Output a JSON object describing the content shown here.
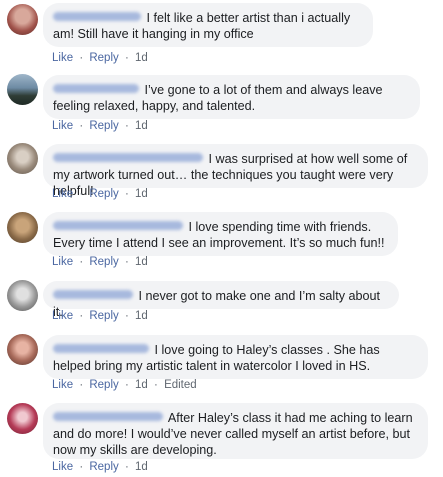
{
  "comments": [
    {
      "text": "I felt like a better artist than i actually am! Still have it hanging in my office",
      "actions": {
        "like": "Like",
        "reply": "Reply",
        "sep": "·",
        "time": "1d"
      }
    },
    {
      "text": "I’ve gone to a lot of them and always leave feeling relaxed, happy, and talented.",
      "actions": {
        "like": "Like",
        "reply": "Reply",
        "sep": "·",
        "time": "1d"
      }
    },
    {
      "text": "I was surprised at how well some of my artwork turned out… the techniques you taught were very helpful!",
      "actions": {
        "like": "Like",
        "reply": "Reply",
        "sep": "·",
        "time": "1d"
      }
    },
    {
      "text": "I love spending time with friends. Every time I attend I see an improvement. It’s so much fun!!",
      "actions": {
        "like": "Like",
        "reply": "Reply",
        "sep": "·",
        "time": "1d"
      }
    },
    {
      "text": "I never got to make one and I’m salty about it.",
      "actions": {
        "like": "Like",
        "reply": "Reply",
        "sep": "·",
        "time": "1d"
      }
    },
    {
      "text": "I love going to Haley’s classes . She has helped bring my artistic talent in watercolor I loved in HS.",
      "actions": {
        "like": "Like",
        "reply": "Reply",
        "sep": "·",
        "time": "1d",
        "edited": "Edited"
      }
    },
    {
      "text": "After Haley’s class it had me aching to learn and do more! I would’ve never called myself an artist before, but now my skills are developing.",
      "actions": {
        "like": "Like",
        "reply": "Reply",
        "sep": "·",
        "time": "1d"
      }
    }
  ],
  "colors": {
    "bubble": "#f2f3f5",
    "link": "#4b67a1",
    "meta": "#606770",
    "text": "#1c1e21",
    "blurred_name": "#8fa6d6"
  },
  "icons": [
    "avatar-photo"
  ]
}
